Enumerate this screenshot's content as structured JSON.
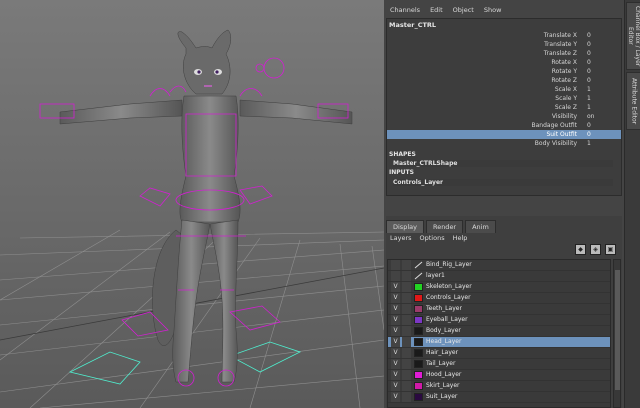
{
  "channel_box": {
    "menu": [
      "Channels",
      "Edit",
      "Object",
      "Show"
    ],
    "node_name": "Master_CTRL",
    "attributes": [
      {
        "name": "Translate X",
        "value": "0"
      },
      {
        "name": "Translate Y",
        "value": "0"
      },
      {
        "name": "Translate Z",
        "value": "0"
      },
      {
        "name": "Rotate X",
        "value": "0"
      },
      {
        "name": "Rotate Y",
        "value": "0"
      },
      {
        "name": "Rotate Z",
        "value": "0"
      },
      {
        "name": "Scale X",
        "value": "1"
      },
      {
        "name": "Scale Y",
        "value": "1"
      },
      {
        "name": "Scale Z",
        "value": "1"
      },
      {
        "name": "Visibility",
        "value": "on"
      },
      {
        "name": "Bandage Outfit",
        "value": "0"
      },
      {
        "name": "Suit Outfit",
        "value": "0"
      },
      {
        "name": "Body Visibility",
        "value": "1"
      }
    ],
    "selected_attribute": "Suit Outfit",
    "shapes_label": "SHAPES",
    "shape_item": "Master_CTRLShape",
    "inputs_label": "INPUTS",
    "input_item": "Controls_Layer"
  },
  "side_tabs": [
    "Channel Box / Layer Editor",
    "Attribute Editor"
  ],
  "layer_editor": {
    "tabs": [
      "Display",
      "Render",
      "Anim"
    ],
    "active_tab": "Display",
    "menu": [
      "Layers",
      "Options",
      "Help"
    ],
    "layers": [
      {
        "name": "Bind_Rig_Layer",
        "visible": "",
        "color": "",
        "icon": "line"
      },
      {
        "name": "layer1",
        "visible": "",
        "color": "",
        "icon": "line"
      },
      {
        "name": "Skeleton_Layer",
        "visible": "V",
        "color": "#22d322"
      },
      {
        "name": "Controls_Layer",
        "visible": "V",
        "color": "#e01818"
      },
      {
        "name": "Teeth_Layer",
        "visible": "V",
        "color": "#9b3b6b"
      },
      {
        "name": "Eyeball_Layer",
        "visible": "V",
        "color": "#7c37c4"
      },
      {
        "name": "Body_Layer",
        "visible": "V",
        "color": "#1a1a1a"
      },
      {
        "name": "Head_Layer",
        "visible": "V",
        "color": "#1a1a1a",
        "selected": true
      },
      {
        "name": "Hair_Layer",
        "visible": "V",
        "color": "#1a1a1a"
      },
      {
        "name": "Tail_Layer",
        "visible": "V",
        "color": "#1a1a1a"
      },
      {
        "name": "Hood_Layer",
        "visible": "V",
        "color": "#e01cd6"
      },
      {
        "name": "Skirt_Layer",
        "visible": "V",
        "color": "#d01aa8"
      },
      {
        "name": "Suit_Layer",
        "visible": "V",
        "color": "#2a0a40"
      }
    ]
  },
  "colors": {
    "selection": "#6d92bc",
    "rig_controls": "#d21fd2",
    "grid": "#8a8a8a",
    "model": "#6a6a6a"
  }
}
